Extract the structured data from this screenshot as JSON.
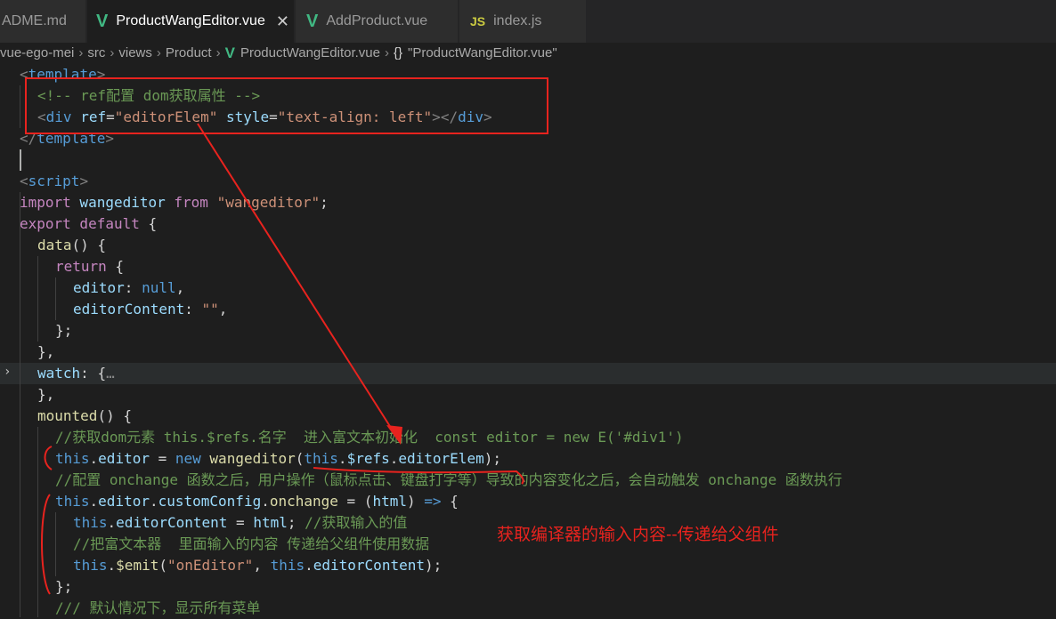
{
  "tabs": [
    {
      "label": "ADME.md",
      "icon": "none",
      "active": false
    },
    {
      "label": "ProductWangEditor.vue",
      "icon": "vue-icon",
      "active": true,
      "close": "✕"
    },
    {
      "label": "AddProduct.vue",
      "icon": "vue-icon",
      "active": false
    },
    {
      "label": "index.js",
      "icon": "js-icon",
      "icon_text": "JS",
      "active": false
    }
  ],
  "breadcrumb": {
    "items": [
      "vue-ego-mei",
      "src",
      "views",
      "Product",
      "ProductWangEditor.vue"
    ],
    "symbol_icon": "{}",
    "symbol": "\"ProductWangEditor.vue\""
  },
  "code": {
    "l1": {
      "open": "<",
      "tag": "template",
      "close": ">"
    },
    "l2": {
      "comment": "<!-- ref配置 dom获取属性 -->"
    },
    "l3": {
      "lt": "<",
      "tag": "div",
      "a1": "ref",
      "eq1": "=",
      "v1": "\"editorElem\"",
      "a2": "style",
      "eq2": "=",
      "v2": "\"text-align: left\"",
      "gt": ">",
      "close_open": "</",
      "close_tag": "div",
      "close_gt": ">"
    },
    "l4": {
      "open": "</",
      "tag": "template",
      "close": ">"
    },
    "l6": {
      "open": "<",
      "tag": "script",
      "close": ">"
    },
    "l7": {
      "kw1": "import",
      "id": " wangeditor ",
      "kw2": "from",
      "sp": " ",
      "str": "\"wangeditor\"",
      "end": ";"
    },
    "l8": {
      "kw1": "export",
      "kw2": " default",
      "end": " {"
    },
    "l9": {
      "fn": "data",
      "end": "() {"
    },
    "l10": {
      "kw": "return",
      "end": " {"
    },
    "l11": {
      "key": "editor",
      "p": ": ",
      "val": "null",
      "end": ","
    },
    "l12": {
      "key": "editorContent",
      "p": ": ",
      "val": "\"\"",
      "end": ","
    },
    "l13": {
      "text": "};"
    },
    "l14": {
      "text": "},"
    },
    "l15": {
      "key": "watch",
      "p": ": {",
      "ellipsis": "…"
    },
    "l16": {
      "text": "},"
    },
    "l17": {
      "fn": "mounted",
      "end": "() {"
    },
    "l18": {
      "comment": "//获取dom元素 this.$refs.名字  进入富文本初始化  const editor = new E('#div1')"
    },
    "l19": {
      "this": "this",
      "dot": ".",
      "prop": "editor",
      "eq": " = ",
      "new": "new",
      "sp": " ",
      "fn": "wangeditor",
      "po": "(",
      "this2": "this",
      "dot2": ".",
      "refs": "$refs",
      "dot3": ".",
      "elem": "editorElem",
      "pc": ");"
    },
    "l20": {
      "comment": "//配置 onchange 函数之后，用户操作（鼠标点击、键盘打字等）导致的内容变化之后，会自动触发 onchange 函数执行"
    },
    "l21": {
      "this": "this",
      "dot": ".",
      "p1": "editor",
      "dot2": ".",
      "p2": "customConfig",
      "dot3": ".",
      "p3": "onchange",
      "eq": " = (",
      "arg": "html",
      "arrow": ") ",
      "ar": "=>",
      "end": " {"
    },
    "l22": {
      "this": "this",
      "dot": ".",
      "prop": "editorContent",
      "eq": " = ",
      "var": "html",
      "semi": "; ",
      "comment": "//获取输入的值"
    },
    "l23": {
      "comment": "//把富文本器  里面输入的内容 传递给父组件使用数据"
    },
    "l24": {
      "this": "this",
      "dot": ".",
      "fn": "$emit",
      "po": "(",
      "str": "\"onEditor\"",
      "comma": ", ",
      "this2": "this",
      "dot2": ".",
      "prop": "editorContent",
      "pc": ");"
    },
    "l25": {
      "text": "};"
    },
    "l26": {
      "comment": "/// 默认情况下，显示所有菜单"
    }
  },
  "annotation": "获取编译器的输入内容--传递给父组件",
  "colors": {
    "annotation_red": "#e8231e",
    "background": "#1e1e1e",
    "vue_green": "#41b883"
  }
}
